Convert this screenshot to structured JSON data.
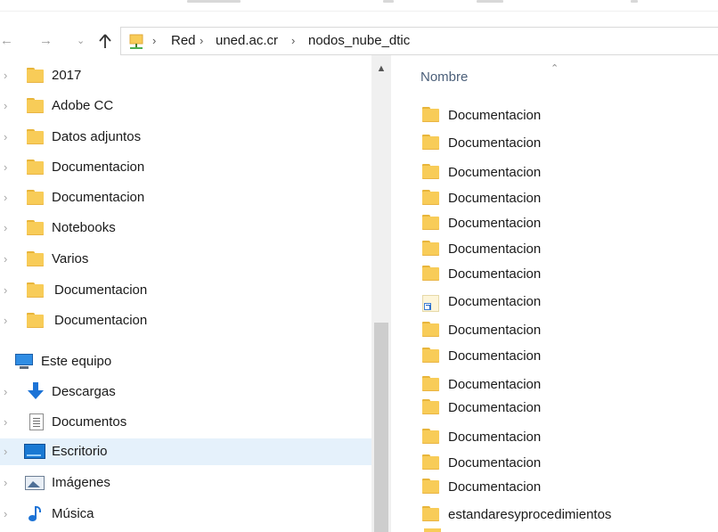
{
  "address_bar": {
    "crumbs": [
      "Red",
      "uned.ac.cr",
      "nodos_nube_dtic"
    ]
  },
  "nav_pane": {
    "folders": [
      "2017",
      "Adobe CC",
      "Datos adjuntos",
      "Documentacion",
      "Documentacion",
      "Notebooks",
      "Varios",
      "Documentacion",
      "Documentacion"
    ],
    "this_pc": "Este equipo",
    "pc_items": [
      "Descargas",
      "Documentos",
      "Escritorio",
      "Imágenes",
      "Música"
    ]
  },
  "file_list": {
    "column_header": "Nombre",
    "items": [
      "Documentacion",
      "Documentacion",
      "Documentacion",
      "Documentacion",
      "Documentacion",
      "Documentacion",
      "Documentacion",
      "Documentacion",
      "Documentacion",
      "Documentacion",
      "Documentacion",
      "Documentacion",
      "Documentacion",
      "Documentacion",
      "Documentacion",
      "estandaresyprocedimientos"
    ]
  },
  "colors": {
    "folder": "#f8cc58",
    "selection": "#e5f1fb",
    "accent": "#1c73d6"
  }
}
